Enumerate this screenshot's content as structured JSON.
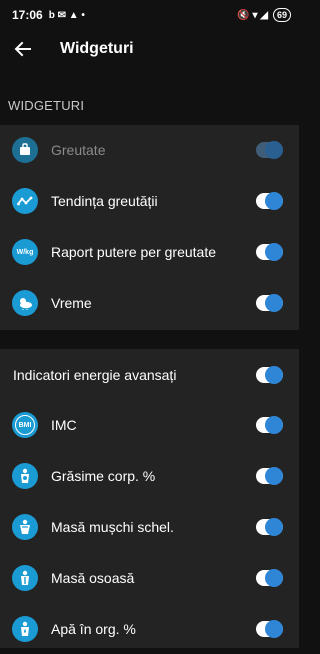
{
  "status": {
    "time": "17:06",
    "battery": "69"
  },
  "appbar": {
    "title": "Widgeturi"
  },
  "section": {
    "title": "WIDGETURI"
  },
  "widgets": [
    {
      "label": "Greutate",
      "icon": "scale-icon",
      "enabled": true,
      "disabled": true
    },
    {
      "label": "Tendința greutății",
      "icon": "trend-icon",
      "enabled": true
    },
    {
      "label": "Raport putere per greutate",
      "icon": "wkg-icon",
      "icon_text": "W/kg",
      "enabled": true
    },
    {
      "label": "Vreme",
      "icon": "weather-icon",
      "enabled": true
    }
  ],
  "advanced": {
    "label": "Indicatori energie avansați",
    "enabled": true,
    "items": [
      {
        "label": "IMC",
        "icon": "bmi-icon",
        "icon_text": "BMI",
        "enabled": true
      },
      {
        "label": "Grăsime corp. %",
        "icon": "body-fat-icon",
        "enabled": true
      },
      {
        "label": "Masă mușchi schel.",
        "icon": "muscle-icon",
        "enabled": true
      },
      {
        "label": "Masă osoasă",
        "icon": "bone-icon",
        "enabled": true
      },
      {
        "label": "Apă în org. %",
        "icon": "water-icon",
        "enabled": true
      }
    ]
  },
  "colors": {
    "accent": "#2f86d6",
    "icon_bg": "#1a9bd4",
    "card": "#232323",
    "background": "#111111"
  }
}
